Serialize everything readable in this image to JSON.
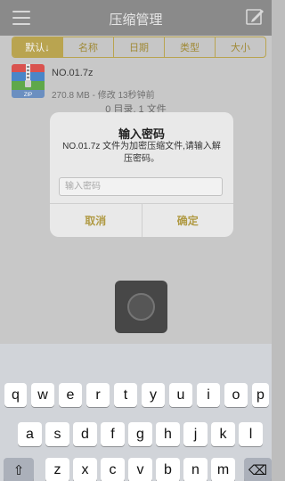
{
  "header": {
    "title": "压缩管理"
  },
  "sort_tabs": [
    {
      "label": "默认↓"
    },
    {
      "label": "名称"
    },
    {
      "label": "日期"
    },
    {
      "label": "类型"
    },
    {
      "label": "大小"
    }
  ],
  "file": {
    "name": "NO.01.7z",
    "meta": "270.8 MB - 修改 13秒钟前",
    "icon_label": "ZIP"
  },
  "summary": "0 目录, 1 文件",
  "dialog": {
    "title": "输入密码",
    "message": "NO.01.7z 文件为加密压缩文件,请输入解压密码。",
    "input_placeholder": "输入密码",
    "cancel_label": "取消",
    "confirm_label": "确定"
  },
  "keyboard": {
    "row1": [
      "q",
      "w",
      "e",
      "r",
      "t",
      "y",
      "u",
      "i",
      "o",
      "p"
    ],
    "row2": [
      "a",
      "s",
      "d",
      "f",
      "g",
      "h",
      "j",
      "k",
      "l"
    ],
    "row3": [
      "z",
      "x",
      "c",
      "v",
      "b",
      "n",
      "m"
    ],
    "shift_icon": "⇧",
    "delete_icon": "⌫"
  },
  "colors": {
    "accent": "#b9a450",
    "header_bg": "#8a8a8a"
  }
}
